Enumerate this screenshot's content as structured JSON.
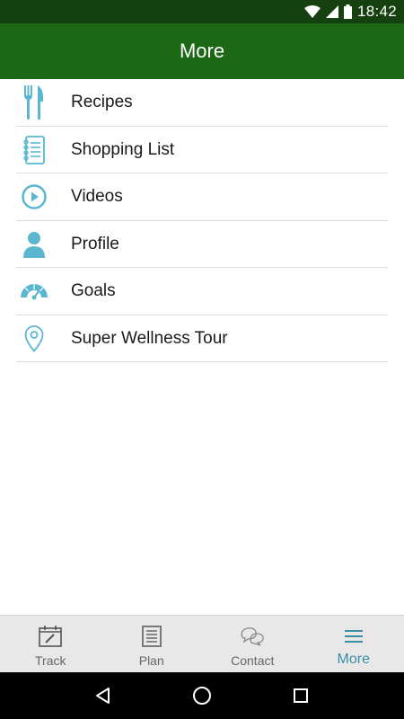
{
  "status_bar": {
    "time": "18:42",
    "icons": [
      "wifi-icon",
      "cell-signal-icon",
      "battery-icon"
    ]
  },
  "app_bar": {
    "title": "More"
  },
  "menu": {
    "items": [
      {
        "label": "Recipes",
        "icon": "fork-knife-icon"
      },
      {
        "label": "Shopping List",
        "icon": "notepad-icon"
      },
      {
        "label": "Videos",
        "icon": "play-circle-icon"
      },
      {
        "label": "Profile",
        "icon": "person-icon"
      },
      {
        "label": "Goals",
        "icon": "gauge-icon"
      },
      {
        "label": "Super Wellness Tour",
        "icon": "map-pin-icon"
      }
    ]
  },
  "bottom_nav": {
    "tabs": [
      {
        "label": "Track",
        "icon": "calendar-edit-icon",
        "active": false
      },
      {
        "label": "Plan",
        "icon": "list-icon",
        "active": false
      },
      {
        "label": "Contact",
        "icon": "chat-bubbles-icon",
        "active": false
      },
      {
        "label": "More",
        "icon": "hamburger-icon",
        "active": true
      }
    ]
  },
  "colors": {
    "status_bar": "#14410f",
    "app_bar": "#1c6815",
    "accent": "#5ab7cf",
    "active_tab": "#3a8ea3"
  }
}
